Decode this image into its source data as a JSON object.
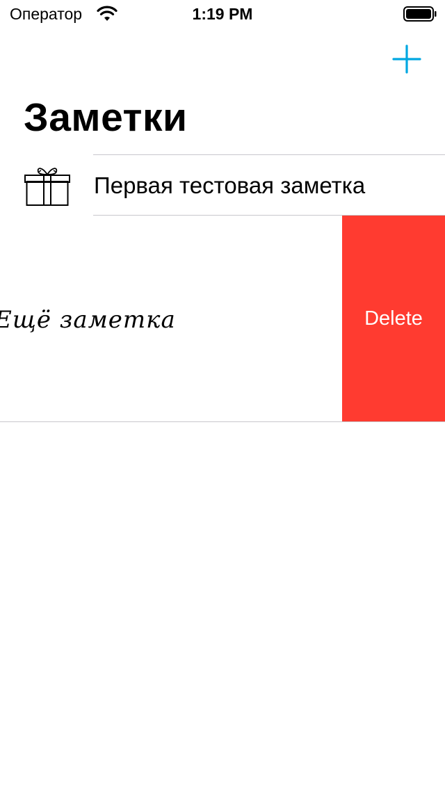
{
  "status_bar": {
    "carrier": "Оператор",
    "time": "1:19 PM"
  },
  "nav": {
    "add_icon": "plus-icon",
    "title": "Заметки",
    "accent_color": "#00a7e1"
  },
  "notes": [
    {
      "title": "Первая тестовая заметка",
      "icon": "gift-icon"
    },
    {
      "title": "Ещё заметка",
      "swiped": true,
      "action_label": "Delete",
      "action_color": "#ff3b30"
    }
  ]
}
